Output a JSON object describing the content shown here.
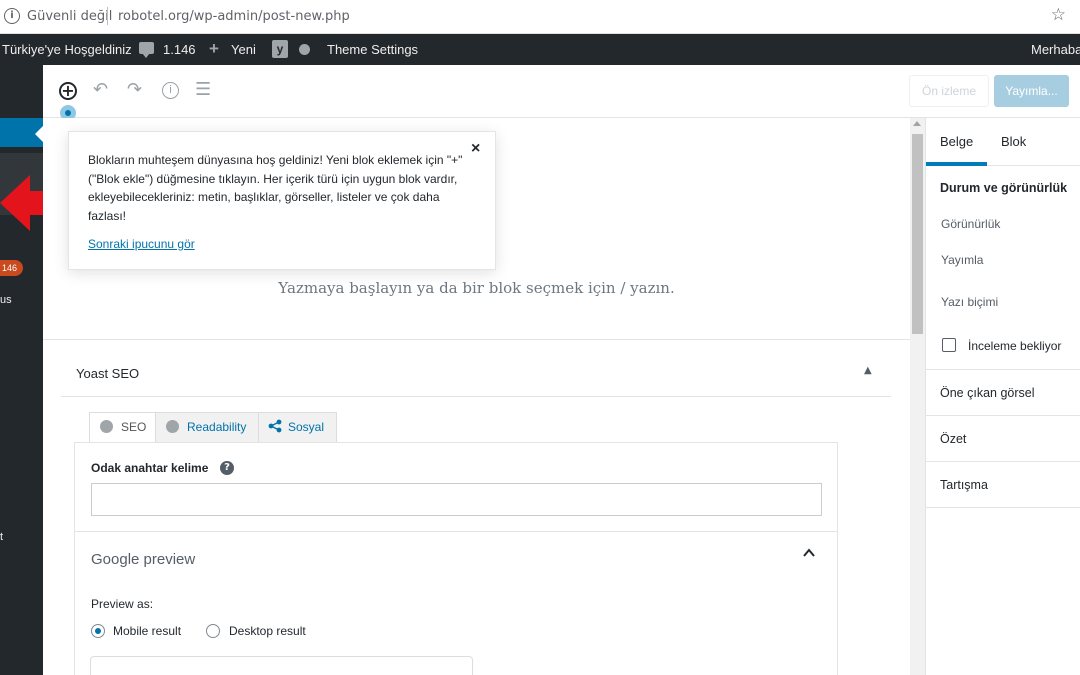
{
  "browser": {
    "secure_label": "Güvenli değil",
    "url": "robotel.org/wp-admin/post-new.php",
    "info_icon": "info-icon",
    "star_icon": "star-icon"
  },
  "adminbar": {
    "site_name": "Türkiye'ye Hoşgeldiniz",
    "comments_count": "1.146",
    "new_label": "Yeni",
    "theme_settings": "Theme Settings",
    "greeting": "Merhaba"
  },
  "sidemenu": {
    "badge": "146",
    "partial_item_1": "us",
    "partial_item_2": "t"
  },
  "toolbar": {
    "preview_label": "Ön izleme",
    "publish_label": "Yayımla..."
  },
  "editor": {
    "placeholder": "Yazmaya başlayın ya da bir blok seçmek için / yazın."
  },
  "tip": {
    "text": "Blokların muhteşem dünyasına hoş geldiniz! Yeni blok eklemek için \"+\" (\"Blok ekle\") düğmesine tıklayın. Her içerik türü için uygun blok vardır, ekleyebilecekleriniz: metin, başlıklar, görseller, listeler ve çok daha fazlası!",
    "link": "Sonraki ipucunu gör"
  },
  "yoast": {
    "title": "Yoast SEO",
    "tabs": [
      {
        "label": "SEO"
      },
      {
        "label": "Readability"
      },
      {
        "label": "Sosyal"
      }
    ],
    "focus_keyword_label": "Odak anahtar kelime",
    "focus_keyword_value": "",
    "google_preview_title": "Google preview",
    "preview_as_label": "Preview as:",
    "radio_options": [
      {
        "label": "Mobile result",
        "selected": true
      },
      {
        "label": "Desktop result",
        "selected": false
      }
    ]
  },
  "sidebar": {
    "tabs": [
      {
        "label": "Belge",
        "active": true
      },
      {
        "label": "Blok",
        "active": false
      }
    ],
    "status_heading": "Durum ve görünürlük",
    "visibility": "Görünürlük",
    "publish": "Yayımla",
    "post_format": "Yazı biçimi",
    "pending_review": "İnceleme bekliyor",
    "featured_image": "Öne çıkan görsel",
    "excerpt": "Özet",
    "discussion": "Tartışma"
  },
  "colors": {
    "admin_dark": "#23282d",
    "wp_blue": "#0073aa",
    "publish_disabled": "#a7cde0",
    "annotation_red": "#e3141b"
  }
}
